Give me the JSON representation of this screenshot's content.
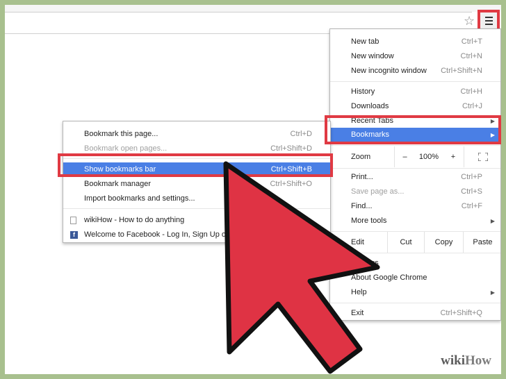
{
  "toolbar": {
    "star_icon": "star-icon",
    "menu_icon": "hamburger-menu-icon"
  },
  "chrome_menu": {
    "group1": [
      {
        "label": "New tab",
        "shortcut": "Ctrl+T"
      },
      {
        "label": "New window",
        "shortcut": "Ctrl+N"
      },
      {
        "label": "New incognito window",
        "shortcut": "Ctrl+Shift+N"
      }
    ],
    "group2": [
      {
        "label": "History",
        "shortcut": "Ctrl+H"
      },
      {
        "label": "Downloads",
        "shortcut": "Ctrl+J"
      },
      {
        "label": "Recent Tabs",
        "shortcut": ""
      },
      {
        "label": "Bookmarks",
        "shortcut": ""
      }
    ],
    "zoom": {
      "label": "Zoom",
      "minus": "–",
      "value": "100%",
      "plus": "+",
      "fullscreen_icon": "fullscreen-icon"
    },
    "group3": [
      {
        "label": "Print...",
        "shortcut": "Ctrl+P"
      },
      {
        "label": "Save page as...",
        "shortcut": "Ctrl+S"
      },
      {
        "label": "Find...",
        "shortcut": "Ctrl+F"
      },
      {
        "label": "More tools",
        "shortcut": ""
      }
    ],
    "edit": {
      "label": "Edit",
      "cut": "Cut",
      "copy": "Copy",
      "paste": "Paste"
    },
    "group4": [
      {
        "label": "Settings",
        "shortcut": ""
      },
      {
        "label": "About Google Chrome",
        "shortcut": ""
      },
      {
        "label": "Help",
        "shortcut": ""
      }
    ],
    "group5": [
      {
        "label": "Exit",
        "shortcut": "Ctrl+Shift+Q"
      }
    ]
  },
  "bookmarks_menu": {
    "items": [
      {
        "label": "Bookmark this page...",
        "shortcut": "Ctrl+D"
      },
      {
        "label": "Bookmark open pages...",
        "shortcut": "Ctrl+Shift+D"
      },
      {
        "label": "Show bookmarks bar",
        "shortcut": "Ctrl+Shift+B"
      },
      {
        "label": "Bookmark manager",
        "shortcut": "Ctrl+Shift+O"
      },
      {
        "label": "Import bookmarks and settings...",
        "shortcut": ""
      }
    ],
    "bookmarks": [
      {
        "label": "wikiHow - How to do anything",
        "icon": "page-icon"
      },
      {
        "label": "Welcome to Facebook - Log In, Sign Up or Learn More",
        "icon": "facebook-icon"
      }
    ]
  },
  "watermark": {
    "wiki": "wiki",
    "how": "How"
  },
  "colors": {
    "highlight": "#4a7fe5",
    "annotation_red": "#e03a43",
    "frame_green": "#a8c08e"
  }
}
